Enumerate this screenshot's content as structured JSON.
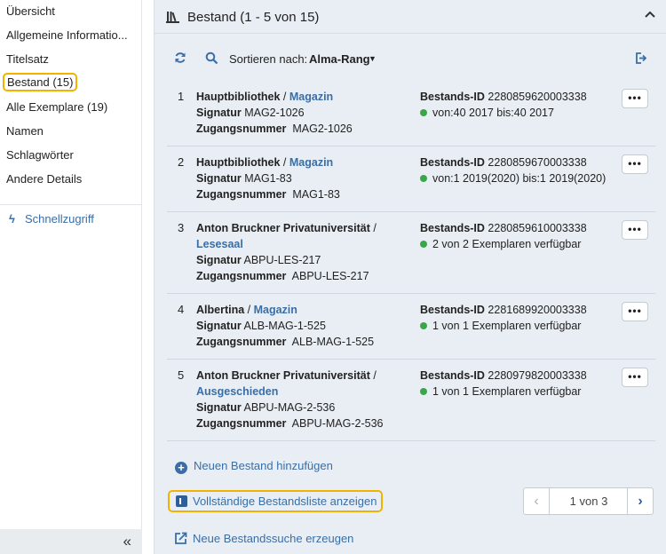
{
  "sidebar": {
    "items": [
      {
        "label": "Übersicht"
      },
      {
        "label": "Allgemeine Informatio..."
      },
      {
        "label": "Titelsatz"
      },
      {
        "label": "Bestand (15)"
      },
      {
        "label": "Alle Exemplare (19)"
      },
      {
        "label": "Namen"
      },
      {
        "label": "Schlagwörter"
      },
      {
        "label": "Andere Details"
      }
    ],
    "quick_access": "Schnellzugriff",
    "collapse_icon": "double-chevron-left-icon"
  },
  "panel": {
    "title": "Bestand (1 - 5 von 15)",
    "toolbar": {
      "sort_label": "Sortieren nach:",
      "sort_value": "Alma-Rang"
    },
    "rows": [
      {
        "num": "1",
        "library": "Hauptbibliothek",
        "sep": " / ",
        "location": "Magazin",
        "signatur_label": "Signatur",
        "signatur": "MAG2-1026",
        "zugang_label": "Zugangsnummer",
        "zugang": "MAG2-1026",
        "id_label": "Bestands-ID",
        "id": "2280859620003338",
        "status": "von:40 2017 bis:40 2017",
        "more": "•••"
      },
      {
        "num": "2",
        "library": "Hauptbibliothek",
        "sep": " / ",
        "location": "Magazin",
        "signatur_label": "Signatur",
        "signatur": "MAG1-83",
        "zugang_label": "Zugangsnummer",
        "zugang": "MAG1-83",
        "id_label": "Bestands-ID",
        "id": "2280859670003338",
        "status": "von:1 2019(2020) bis:1 2019(2020)",
        "more": "•••"
      },
      {
        "num": "3",
        "library": "Anton Bruckner Privatuniversität",
        "sep": " /",
        "location": "Lesesaal",
        "signatur_label": "Signatur",
        "signatur": "ABPU-LES-217",
        "zugang_label": "Zugangsnummer",
        "zugang": "ABPU-LES-217",
        "id_label": "Bestands-ID",
        "id": "2280859610003338",
        "status": "2 von 2 Exemplaren verfügbar",
        "more": "•••"
      },
      {
        "num": "4",
        "library": "Albertina",
        "sep": " / ",
        "location": "Magazin",
        "signatur_label": "Signatur",
        "signatur": "ALB-MAG-1-525",
        "zugang_label": "Zugangsnummer",
        "zugang": "ALB-MAG-1-525",
        "id_label": "Bestands-ID",
        "id": "2281689920003338",
        "status": "1 von 1 Exemplaren verfügbar",
        "more": "•••"
      },
      {
        "num": "5",
        "library": "Anton Bruckner Privatuniversität",
        "sep": " /",
        "location": "Ausgeschieden",
        "signatur_label": "Signatur",
        "signatur": "ABPU-MAG-2-536",
        "zugang_label": "Zugangsnummer",
        "zugang": "ABPU-MAG-2-536",
        "id_label": "Bestands-ID",
        "id": "2280979820003338",
        "status": "1 von 1 Exemplaren verfügbar",
        "more": "•••"
      }
    ],
    "add_holding": "Neuen Bestand hinzufügen",
    "full_list": "Vollständige Bestandsliste anzeigen",
    "pager": {
      "text": "1 von 3",
      "prev": "‹",
      "next": "›"
    },
    "new_search": "Neue Bestandssuche erzeugen"
  },
  "colors": {
    "accent": "#3a6ea5",
    "highlight": "#f0b400",
    "available": "#3aa64a",
    "panel_bg": "#e8eef4"
  }
}
